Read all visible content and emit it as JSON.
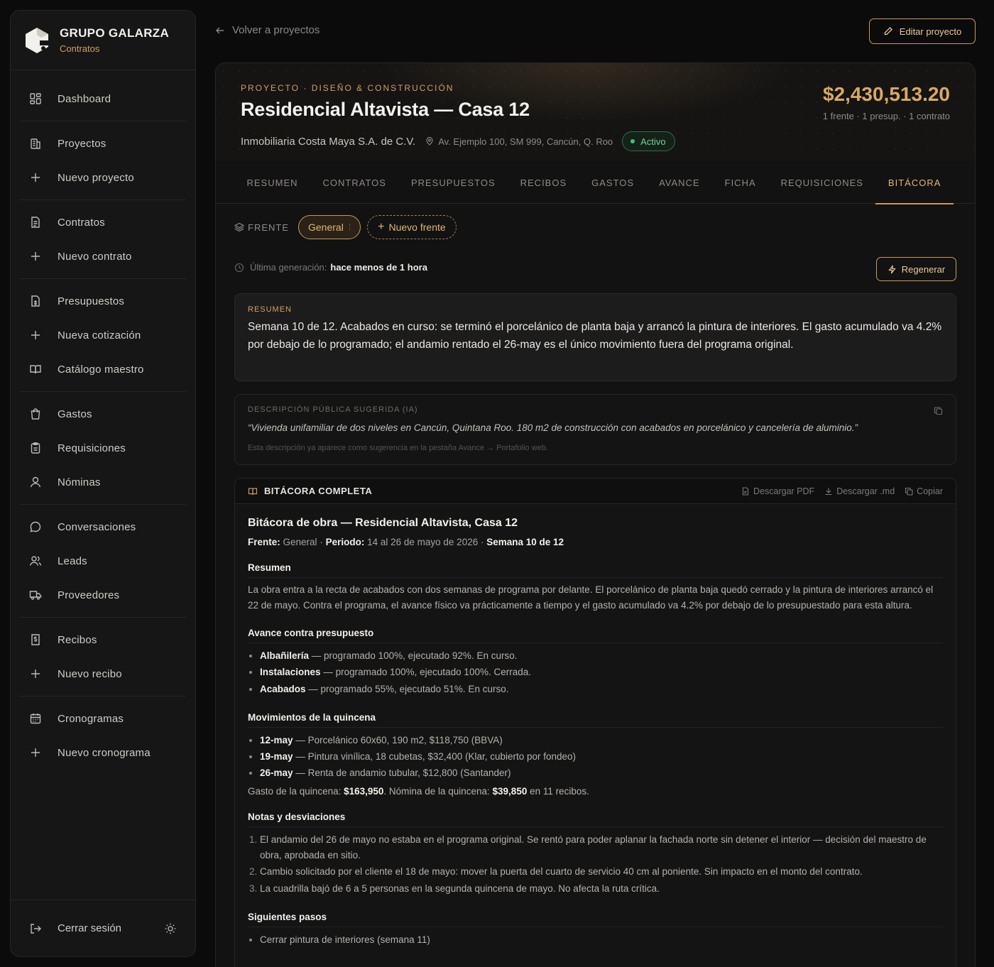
{
  "brand": {
    "name": "GRUPO GALARZA",
    "subtitle": "Contratos"
  },
  "sidebar": {
    "items": [
      {
        "label": "Dashboard",
        "icon": "dashboard-icon"
      },
      {
        "label": "Proyectos",
        "icon": "building-icon"
      },
      {
        "label": "Nuevo proyecto",
        "icon": "plus-icon"
      },
      {
        "label": "Contratos",
        "icon": "document-icon"
      },
      {
        "label": "Nuevo contrato",
        "icon": "plus-icon"
      },
      {
        "label": "Presupuestos",
        "icon": "calculator-doc-icon"
      },
      {
        "label": "Nueva cotización",
        "icon": "plus-icon"
      },
      {
        "label": "Catálogo maestro",
        "icon": "book-open-icon"
      },
      {
        "label": "Gastos",
        "icon": "shopping-bag-icon"
      },
      {
        "label": "Requisiciones",
        "icon": "clipboard-icon"
      },
      {
        "label": "Nóminas",
        "icon": "user-icon"
      },
      {
        "label": "Conversaciones",
        "icon": "chat-bubble-icon"
      },
      {
        "label": "Leads",
        "icon": "users-icon"
      },
      {
        "label": "Proveedores",
        "icon": "truck-icon"
      },
      {
        "label": "Recibos",
        "icon": "receipt-icon"
      },
      {
        "label": "Nuevo recibo",
        "icon": "plus-icon"
      },
      {
        "label": "Cronogramas",
        "icon": "calendar-icon"
      },
      {
        "label": "Nuevo cronograma",
        "icon": "plus-icon"
      }
    ],
    "logout_label": "Cerrar sesión"
  },
  "topbar": {
    "back_label": "Volver a proyectos",
    "edit_label": "Editar proyecto"
  },
  "project": {
    "eyebrow": "PROYECTO · DISEÑO & CONSTRUCCIÓN",
    "title": "Residencial Altavista — Casa 12",
    "client": "Inmobiliaria Costa Maya S.A. de C.V.",
    "address": "Av. Ejemplo 100, SM 999, Cancún, Q. Roo",
    "status": "Activo",
    "status_color": "#3fc27a",
    "amount": "$2,430,513.20",
    "amount_sub": "1 frente · 1 presup. · 1 contrato"
  },
  "tabs": [
    "RESUMEN",
    "CONTRATOS",
    "PRESUPUESTOS",
    "RECIBOS",
    "GASTOS",
    "AVANCE",
    "FICHA",
    "REQUISICIONES",
    "BITÁCORA"
  ],
  "active_tab": "BITÁCORA",
  "frente": {
    "label": "FRENTE",
    "selected": "General",
    "new_label": "Nuevo frente"
  },
  "generation": {
    "label": "Última generación:",
    "value": "hace menos de 1 hora",
    "regen_label": "Regenerar"
  },
  "summary": {
    "label": "RESUMEN",
    "text": "Semana 10 de 12. Acabados en curso: se terminó el porcelánico de planta baja y arrancó la pintura de interiores. El gasto acumulado va 4.2% por debajo de lo programado; el andamio rentado el 26-may es el único movimiento fuera del programa original."
  },
  "public_desc": {
    "label": "DESCRIPCIÓN PÚBLICA SUGERIDA (IA)",
    "text": "“Vivienda unifamiliar de dos niveles en Cancún, Quintana Roo. 180 m2 de construcción con acabados en porcelánico y cancelería de aluminio.”",
    "note": "Esta descripción ya aparece como sugerencia en la pestaña Avance → Portafolio web."
  },
  "bitacora": {
    "header": "BITÁCORA COMPLETA",
    "actions": {
      "pdf": "Descargar PDF",
      "md": "Descargar .md",
      "copy": "Copiar"
    },
    "title": "Bitácora de obra — Residencial Altavista, Casa 12",
    "meta": {
      "frente_label": "Frente:",
      "frente_value": "General",
      "periodo_label": "Periodo:",
      "periodo_value": "14 al 26 de mayo de 2026",
      "semana": "Semana 10 de 12"
    },
    "resumen_heading": "Resumen",
    "resumen_text": "La obra entra a la recta de acabados con dos semanas de programa por delante. El porcelánico de planta baja quedó cerrado y la pintura de interiores arrancó el 22 de mayo. Contra el programa, el avance físico va prácticamente a tiempo y el gasto acumulado va 4.2% por debajo de lo presupuestado para esta altura.",
    "avance_heading": "Avance contra presupuesto",
    "avance_items": [
      {
        "name": "Albañilería",
        "text": "— programado 100%, ejecutado 92%. En curso."
      },
      {
        "name": "Instalaciones",
        "text": "— programado 100%, ejecutado 100%. Cerrada."
      },
      {
        "name": "Acabados",
        "text": "— programado 55%, ejecutado 51%. En curso."
      }
    ],
    "mov_heading": "Movimientos de la quincena",
    "mov_items": [
      {
        "date": "12-may",
        "text": "— Porcelánico 60x60, 190 m2, $118,750 (BBVA)"
      },
      {
        "date": "19-may",
        "text": "— Pintura vinílica, 18 cubetas, $32,400 (Klar, cubierto por fondeo)"
      },
      {
        "date": "26-may",
        "text": "— Renta de andamio tubular, $12,800 (Santander)"
      }
    ],
    "gasto": {
      "l1": "Gasto de la quincena:",
      "v1": "$163,950",
      "l2": ". Nómina de la quincena:",
      "v2": "$39,850",
      "l3": "en 11 recibos."
    },
    "notas_heading": "Notas y desviaciones",
    "notas": [
      "El andamio del 26 de mayo no estaba en el programa original. Se rentó para poder aplanar la fachada norte sin detener el interior — decisión del maestro de obra, aprobada en sitio.",
      "Cambio solicitado por el cliente el 18 de mayo: mover la puerta del cuarto de servicio 40 cm al poniente. Sin impacto en el monto del contrato.",
      "La cuadrilla bajó de 6 a 5 personas en la segunda quincena de mayo. No afecta la ruta crítica."
    ],
    "pasos_heading": "Siguientes pasos",
    "pasos": [
      "Cerrar pintura de interiores (semana 11)"
    ]
  },
  "colors": {
    "accent": "#c79a5e",
    "background": "#0b0b0b",
    "panel": "#121212"
  }
}
